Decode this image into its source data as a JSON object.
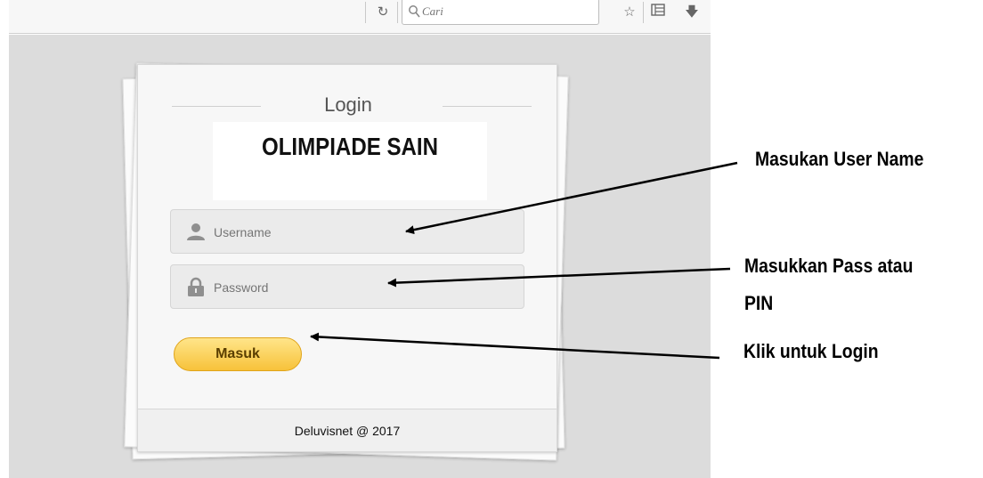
{
  "browser": {
    "search_placeholder": "Cari",
    "icons": [
      "reload-icon",
      "search-icon",
      "star-icon",
      "reading-list-icon",
      "download-icon"
    ]
  },
  "login_card": {
    "title": "Login",
    "brand_title": "OLIMPIADE SAIN",
    "username_placeholder": "Username",
    "password_placeholder": "Password",
    "submit_label": "Masuk",
    "footer": "Deluvisnet @ 2017"
  },
  "annotations": {
    "username": "Masukan User Name",
    "password_line1": "Masukkan Pass atau",
    "password_line2": "PIN",
    "login": "Klik untuk Login"
  },
  "colors": {
    "button_top": "#ffe58a",
    "button_bottom": "#f7c23a",
    "page_bg": "#dcdcdc"
  }
}
